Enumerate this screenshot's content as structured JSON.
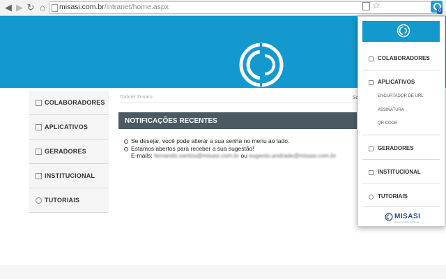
{
  "browser": {
    "url_host": "misasi.com.br",
    "url_path": "/intranet/home.aspx",
    "ext_badge": "0"
  },
  "user": {
    "name": "Gabriel Zonaro",
    "status_short": "Sa"
  },
  "sidebar": {
    "items": [
      {
        "label": "COLABORADORES"
      },
      {
        "label": "APLICATIVOS"
      },
      {
        "label": "GERADORES"
      },
      {
        "label": "INSTITUCIONAL"
      },
      {
        "label": "TUTORIAIS"
      }
    ]
  },
  "notifications": {
    "title": "NOTIFICAÇÕES RECENTES",
    "line1": "Se desejar, você pode alterar a sua senha no menu ao lado.",
    "line2": "Estamos abertos para receber a sua sugestão!",
    "emails_prefix": "E-mails:",
    "email1": "fernando.santos@misasi.com.br",
    "or_word": "ou",
    "email2": "eugenio.andrade@misasi.com.br"
  },
  "popup": {
    "items": {
      "colaboradores": "COLABORADORES",
      "aplicativos": "APLICATIVOS",
      "sub1": "ENCURTADOR DE URL",
      "sub2": "ASSINATURA",
      "sub3": "QR CODE",
      "geradores": "GERADORES",
      "institucional": "INSTITUCIONAL",
      "tutoriais": "TUTORIAIS"
    },
    "brand": "MISASI",
    "tagline": "SOLUÇÕES DIGITAIS"
  },
  "colors": {
    "banner": "#1499cf",
    "notif_header": "#4a5962"
  },
  "icons": [
    "back-icon",
    "forward-icon",
    "reload-icon",
    "home-icon",
    "page-icon",
    "star-icon",
    "extension-icon",
    "people-icon",
    "apps-icon",
    "generator-icon",
    "folder-icon",
    "tutorial-icon"
  ]
}
